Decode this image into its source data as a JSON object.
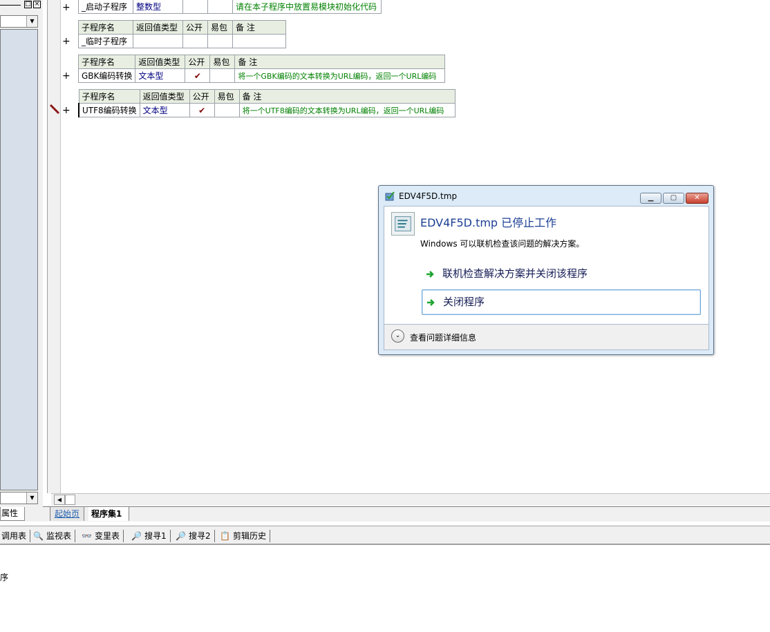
{
  "left_panel": {
    "tab_label": "属性"
  },
  "editor": {
    "header": {
      "name": "子程序名",
      "return_type": "返回值类型",
      "public": "公开",
      "easy_pack": "易包",
      "note": "备 注"
    },
    "rows": [
      {
        "expand": "+",
        "name": "_启动子程序",
        "return_type": "整数型",
        "public": "",
        "easy_pack": "",
        "note": "请在本子程序中放置易模块初始化代码"
      },
      {
        "expand": "+",
        "name": "_临时子程序",
        "return_type": "",
        "public": "",
        "easy_pack": "",
        "note": ""
      },
      {
        "expand": "+",
        "name": "GBK编码转换",
        "return_type": "文本型",
        "public": "✔",
        "easy_pack": "",
        "note": "将一个GBK编码的文本转换为URL编码，返回一个URL编码"
      },
      {
        "expand": "+",
        "name": "UTF8编码转换",
        "return_type": "文本型",
        "public": "✔",
        "easy_pack": "",
        "note": "将一个UTF8编码的文本转换为URL编码，返回一个URL编码"
      }
    ],
    "doc_tabs": {
      "home": "起始页",
      "program_set": "程序集1"
    }
  },
  "toolbar": {
    "items": [
      {
        "icon": "",
        "label": "调用表"
      },
      {
        "icon": "🔍",
        "label": "监视表"
      },
      {
        "icon": "👓",
        "label": "变里表"
      },
      {
        "icon": "🔎",
        "label": "搜寻1"
      },
      {
        "icon": "🔎",
        "label": "搜寻2"
      },
      {
        "icon": "📋",
        "label": "剪辑历史"
      }
    ]
  },
  "output": {
    "text": "序"
  },
  "dialog": {
    "title": "EDV4F5D.tmp",
    "heading": "EDV4F5D.tmp 已停止工作",
    "description": "Windows 可以联机检查该问题的解决方案。",
    "commands": [
      "联机检查解决方案并关闭该程序",
      "关闭程序"
    ],
    "details_label": "查看问题详细信息",
    "colors": {
      "heading": "#1c3f94",
      "command_arrow": "#1aa530",
      "close_button": "#c9402d"
    }
  }
}
